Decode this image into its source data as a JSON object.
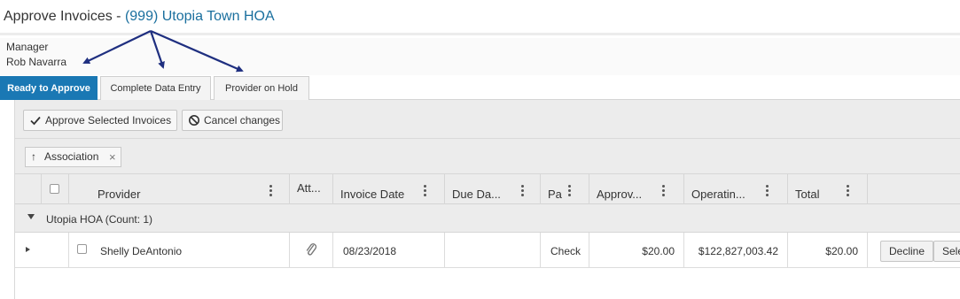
{
  "header": {
    "title_prefix": "Approve Invoices - ",
    "association_link": "(999) Utopia Town HOA"
  },
  "manager": {
    "label": "Manager",
    "name": "Rob Navarra"
  },
  "tabs": [
    {
      "label": "Ready to Approve",
      "active": true
    },
    {
      "label": "Complete Data Entry",
      "active": false
    },
    {
      "label": "Provider on Hold",
      "active": false
    }
  ],
  "toolbar": {
    "approve_label": "Approve Selected Invoices",
    "cancel_label": "Cancel changes"
  },
  "grouping": {
    "chip_label": "Association",
    "sort_glyph": "↑",
    "remove_glyph": "×"
  },
  "columns": [
    "Provider",
    "Att...",
    "Invoice Date",
    "Due Da...",
    "Pa",
    "Approv...",
    "Operatin...",
    "Total"
  ],
  "group": {
    "label": "Utopia HOA (Count: 1)"
  },
  "rows": [
    {
      "provider": "Shelly DeAntonio",
      "invoice_date": "08/23/2018",
      "due_date": "",
      "payment": "Check",
      "approved": "$20.00",
      "operating": "$122,827,003.42",
      "total": "$20.00",
      "decline_label": "Decline",
      "select_label": "Select"
    }
  ],
  "colors": {
    "accent": "#1a78b4",
    "link": "#1a6f9e",
    "arrow": "#1f2f80"
  },
  "icons": [
    "check-icon",
    "cancel-icon",
    "sort-up-icon",
    "remove-icon",
    "column-menu-icon",
    "paperclip-icon",
    "expand-caret-icon",
    "collapse-caret-icon"
  ]
}
